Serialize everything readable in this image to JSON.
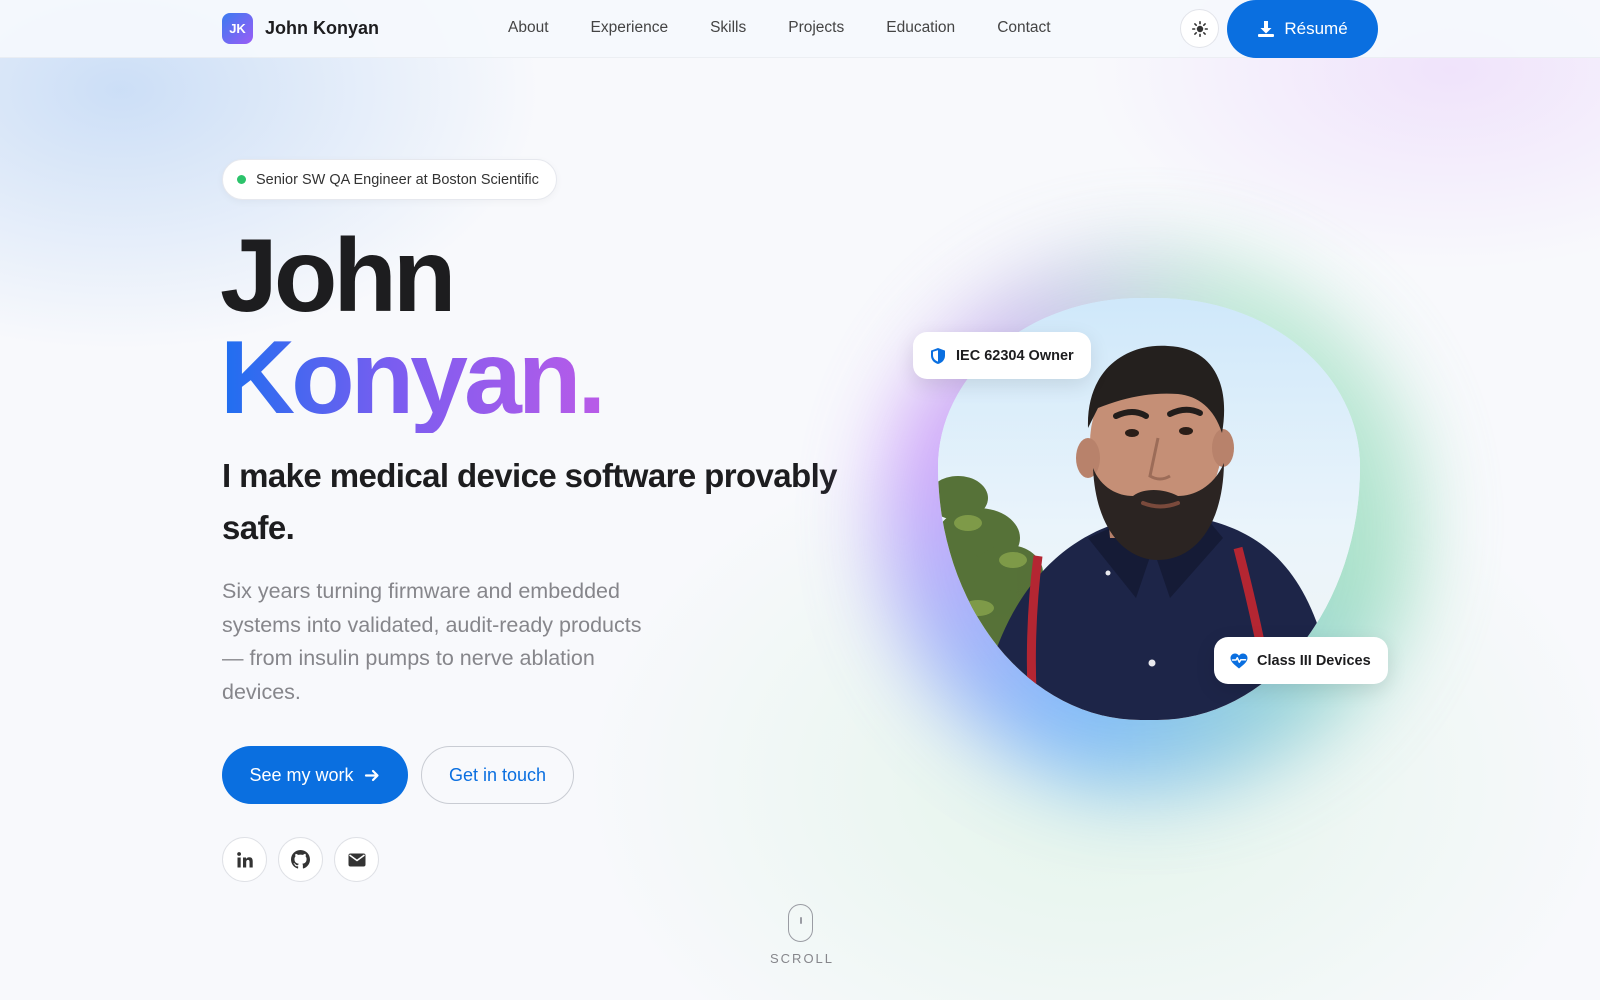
{
  "nav": {
    "brand_initials": "JK",
    "brand_name": "John Konyan",
    "links": [
      "About",
      "Experience",
      "Skills",
      "Projects",
      "Education",
      "Contact"
    ],
    "theme_toggle_icon": "sun-icon",
    "resume_label": "Résumé",
    "resume_icon": "download-icon"
  },
  "hero": {
    "status_badge": "Senior SW QA Engineer at Boston Scientific",
    "name_first": "John",
    "name_last": "Konyan.",
    "tagline": "I make medical device software provably safe.",
    "description": "Six years turning firmware and embedded systems into validated, audit-ready products — from insulin pumps to nerve ablation devices.",
    "primary_cta": "See my work",
    "secondary_cta": "Get in touch",
    "socials": [
      "linkedin-icon",
      "github-icon",
      "email-icon"
    ],
    "scroll_label": "SCROLL"
  },
  "portrait": {
    "badges": [
      {
        "label": "IEC 62304 Owner",
        "icon": "shield-icon"
      },
      {
        "label": "Class III Devices",
        "icon": "heart-pulse-icon"
      }
    ]
  },
  "colors": {
    "accent": "#0a6fe0",
    "gradient_start": "#1e6ff0",
    "gradient_end": "#b95be8",
    "status_dot": "#2cc36b"
  }
}
